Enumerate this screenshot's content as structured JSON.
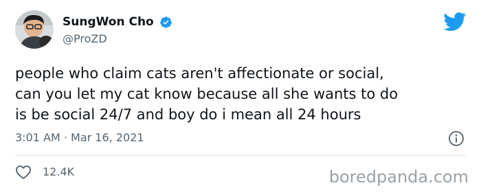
{
  "author": {
    "display_name": "SungWon Cho",
    "handle": "@ProZD",
    "verified": true
  },
  "tweet": {
    "text": "people who claim cats aren't affectionate or social,\ncan you let my cat know because all she wants to do\nis be social 24/7 and boy do i mean all 24 hours",
    "timestamp": "3:01 AM · Mar 16, 2021",
    "likes": "12.4K"
  },
  "icons": {
    "brand": "twitter-bird-icon",
    "verified": "verified-badge-icon",
    "info": "info-icon",
    "like": "heart-icon"
  },
  "colors": {
    "brand_blue": "#1d9bf0",
    "secondary_text": "#536471",
    "watermark": "#9aa1a6"
  },
  "watermark": "boredpanda.com"
}
